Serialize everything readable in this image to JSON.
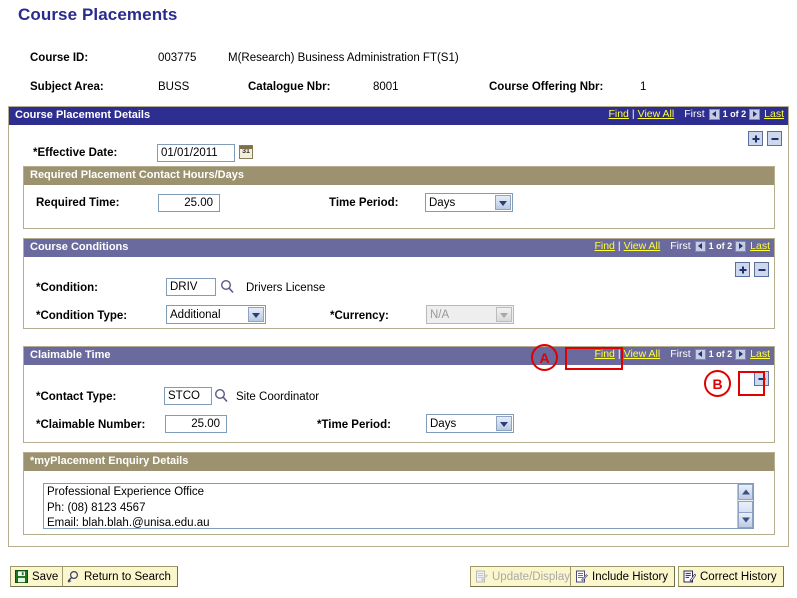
{
  "page": {
    "title": "Course Placements"
  },
  "header": {
    "course_id_label": "Course ID:",
    "course_id_value": "003775",
    "course_title": "M(Research) Business Administration FT(S1)",
    "subject_area_label": "Subject Area:",
    "subject_area_value": "BUSS",
    "catalogue_nbr_label": "Catalogue Nbr:",
    "catalogue_nbr_value": "8001",
    "course_offering_nbr_label": "Course Offering Nbr:",
    "course_offering_nbr_value": "1"
  },
  "placement_details": {
    "section_title": "Course Placement Details",
    "nav": {
      "find": "Find",
      "separator": "|",
      "view_all": "View All",
      "first": "First",
      "count": "1 of 2",
      "last": "Last"
    },
    "effective_date_label": "*Effective Date:",
    "effective_date_value": "01/01/2011",
    "calendar_icon_glyph": "31"
  },
  "required_hours": {
    "section_title": "Required Placement Contact Hours/Days",
    "required_time_label": "Required Time:",
    "required_time_value": "25.00",
    "time_period_label": "Time Period:",
    "time_period_value": "Days"
  },
  "course_conditions": {
    "section_title": "Course Conditions",
    "nav": {
      "find": "Find",
      "separator": "|",
      "view_all": "View All",
      "first": "First",
      "count": "1 of 2",
      "last": "Last"
    },
    "condition_label": "*Condition:",
    "condition_value": "DRIV",
    "condition_description": "Drivers License",
    "condition_type_label": "*Condition Type:",
    "condition_type_value": "Additional",
    "currency_label": "*Currency:",
    "currency_value": "N/A"
  },
  "claimable_time": {
    "section_title": "Claimable Time",
    "nav": {
      "find": "Find",
      "separator": "|",
      "view_all": "View All",
      "first": "First",
      "count": "1 of 2",
      "last": "Last"
    },
    "contact_type_label": "*Contact Type:",
    "contact_type_value": "STCO",
    "contact_type_description": "Site Coordinator",
    "claimable_number_label": "*Claimable Number:",
    "claimable_number_value": "25.00",
    "time_period_label": "*Time Period:",
    "time_period_value": "Days"
  },
  "enquiry_details": {
    "section_title": "*myPlacement Enquiry Details",
    "text": "Professional Experience Office\nPh: (08) 8123 4567\nEmail: blah.blah.@unisa.edu.au"
  },
  "annotations": [
    {
      "label": "A",
      "target": "view-all-link-claimable-time"
    },
    {
      "label": "B",
      "target": "delete-row-button-claimable-time"
    }
  ],
  "toolbar": {
    "save": "Save",
    "return_to_search": "Return to Search",
    "update_display": "Update/Display",
    "include_history": "Include History",
    "correct_history": "Correct History"
  },
  "colors": {
    "title_blue": "#2b2b8f",
    "header_navy": "#2e2e91",
    "header_slate": "#6a6a9e",
    "header_tan": "#9c9270",
    "link_yellow": "#ffff33",
    "annotation_red": "#e00000",
    "button_yellow": "#fbf6cc"
  }
}
